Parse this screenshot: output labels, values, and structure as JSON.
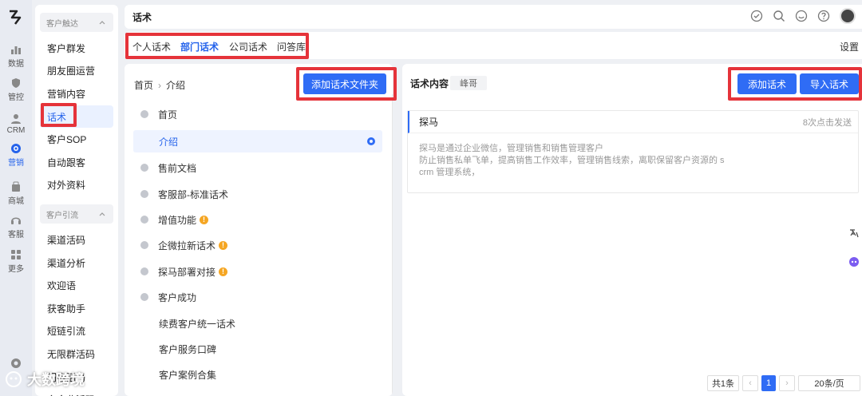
{
  "rail": {
    "items": [
      {
        "label": "数据",
        "icon": "chart-icon"
      },
      {
        "label": "管控",
        "icon": "shield-icon"
      },
      {
        "label": "CRM",
        "icon": "person-icon"
      },
      {
        "label": "营销",
        "icon": "target-icon"
      },
      {
        "label": "商城",
        "icon": "shop-icon"
      },
      {
        "label": "客服",
        "icon": "headset-icon"
      },
      {
        "label": "更多",
        "icon": "grid-icon"
      }
    ]
  },
  "menu": {
    "group1": "客户触达",
    "items1": [
      "客户群发",
      "朋友圈运营",
      "营销内容",
      "话术",
      "客户SOP",
      "自动跟客",
      "对外资料"
    ],
    "group2": "客户引流",
    "items2": [
      "渠道活码",
      "渠道分析",
      "欢迎语",
      "获客助手",
      "短链引流",
      "无限群活码",
      "门店活码",
      "多企业活码"
    ]
  },
  "topbar": {
    "title": "话术"
  },
  "tabs": [
    "个人话术",
    "部门话术",
    "公司话术",
    "问答库"
  ],
  "settings_label": "设置",
  "left": {
    "crumb_root": "首页",
    "crumb_current": "介绍",
    "add_folder_label": "添加话术文件夹",
    "tree": [
      {
        "label": "首页",
        "type": "root"
      },
      {
        "label": "介绍",
        "type": "selected"
      },
      {
        "label": "售前文档",
        "type": "folder"
      },
      {
        "label": "客服部-标准话术",
        "type": "folder"
      },
      {
        "label": "增值功能",
        "type": "folder",
        "warn": true
      },
      {
        "label": "企微拉新话术",
        "type": "folder",
        "warn": true
      },
      {
        "label": "探马部署对接",
        "type": "folder",
        "warn": true
      },
      {
        "label": "客户成功",
        "type": "folder"
      },
      {
        "label": "续费客户统一话术",
        "type": "child"
      },
      {
        "label": "客户服务口碑",
        "type": "child"
      },
      {
        "label": "客户案例合集",
        "type": "child"
      }
    ]
  },
  "right": {
    "title": "话术内容",
    "tag": "峰哥",
    "add_label": "添加话术",
    "import_label": "导入话术",
    "card": {
      "name": "探马",
      "sent": "8次点击发送",
      "line1": "探马是通过企业微信，管理销售和销售管理客户",
      "line2": "防止销售私单飞单，提高销售工作效率，管理销售线索，离职保留客户资源的 s",
      "line3": "crm 管理系统，"
    },
    "pager": {
      "total": "共1条",
      "page": "1",
      "size": "20条/页"
    }
  },
  "watermark": "大数跨境",
  "colors": {
    "primary": "#2f6cf5",
    "highlight": "#e5333a",
    "warn": "#f5a623"
  }
}
